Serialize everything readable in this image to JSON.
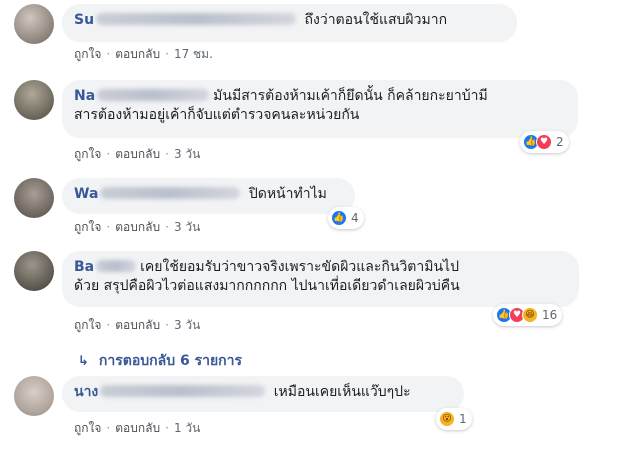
{
  "actions": {
    "like": "ถูกใจ",
    "reply": "ตอบกลับ",
    "dot": "·"
  },
  "comments": [
    {
      "author": "Su",
      "text": "ถึงว่าตอนใช้แสบผิวมาก",
      "time": "17 ชม."
    },
    {
      "author": "Na",
      "text_line1": "มันมีสารต้องห้ามเค้าก็ยึดนั้น ก็คล้ายกะยาบ้ามี",
      "text_line2": "สารต้องห้ามอยู่เค้าก็จับแต่ตำรวจคนละหน่วยกัน",
      "time": "3 วัน",
      "reactions": [
        "like",
        "love"
      ],
      "reaction_count": "2"
    },
    {
      "author": "Wa",
      "text": "ปิดหน้าทำไม",
      "time": "3 วัน",
      "reactions": [
        "like"
      ],
      "reaction_count": "4"
    },
    {
      "author": "Ba",
      "text_line1": "เคยใช้ยอมรับว่าขาวจริงเพราะขัดผิวและกินวิตามินไป",
      "text_line2": "ด้วย สรุปคือผิวไวต่อแสงมากกกกกก ไปนาเที่อเดียวดำเลยผิวบ่คืน",
      "time": "3 วัน",
      "reactions": [
        "like",
        "love",
        "haha"
      ],
      "reaction_count": "16"
    },
    {
      "author": "นาง",
      "text": "เหมือนเคยเห็นแว๊บๆปะ",
      "time": "1 วัน",
      "reactions": [
        "wow"
      ],
      "reaction_count": "1"
    }
  ],
  "replies_link": "การตอบกลับ 6 รายการ",
  "colors": {
    "link": "#385898",
    "bubble": "#f2f3f5",
    "like": "#1877f2",
    "love": "#f33e58",
    "wow": "#f7b125"
  },
  "icons": {
    "replies": "reply-arrow-icon",
    "like": "like-icon",
    "love": "love-icon",
    "haha": "haha-icon",
    "wow": "wow-icon"
  }
}
